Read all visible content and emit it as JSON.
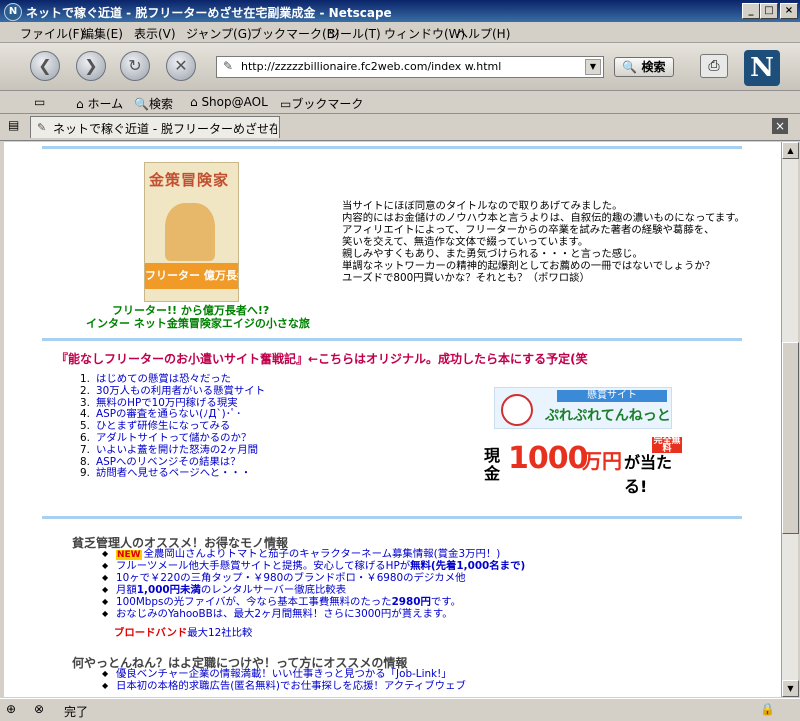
{
  "window": {
    "title": "ネットで稼ぐ近道 - 脱フリーターめざせ在宅副業成金 - Netscape",
    "btn_min": "_",
    "btn_max": "□",
    "btn_close": "×"
  },
  "menu": [
    "ファイル(F)",
    "編集(E)",
    "表示(V)",
    "ジャンプ(G)",
    "ブックマーク(B)",
    "ツール(T)",
    "ウィンドウ(W)",
    "ヘルプ(H)"
  ],
  "nav": {
    "url": "http://zzzzzbillionaire.fc2web.com/index w.html",
    "search_label": "検索",
    "back_glyph": "❮",
    "forward_glyph": "❯",
    "reload_glyph": "↻",
    "stop_glyph": "✕",
    "logo_text": "N"
  },
  "personal_toolbar": {
    "home": "ホーム",
    "search": "検索",
    "shop": "Shop@AOL",
    "bookmarks": "ブックマーク"
  },
  "tab": {
    "label": "ネットで稼ぐ近道 - 脱フリーターめざせ在宅副…"
  },
  "book": {
    "cover_title": "金策冒険家",
    "cover_band": "フリーター 億万長者",
    "caption_line1": "フリーター!! から億万長者へ!?",
    "caption_line2": "インター ネット金策冒険家エイジの小さな旅"
  },
  "intro_lines": [
    "当サイトにほぼ同意のタイトルなので取りあげてみました。",
    "内容的にはお金儲けのノウハウ本と言うよりは、自叙伝的趣の濃いものになってます。",
    "アフィリエイトによって、フリーターからの卒業を試みた著者の経験や葛藤を、",
    "笑いを交えて、無造作な文体で綴っていっています。",
    "親しみやすくもあり、また勇気づけられる・・・と言った感じ。",
    "単調なネットワーカーの精神的起爆剤としてお薦めの一冊ではないでしょうか？",
    "ユーズドで800円買いかな？それとも？（ポワロ談）"
  ],
  "section1": {
    "heading": "『能なしフリーターのお小遣いサイト奮戦記』←こちらはオリジナル。成功したら本にする予定(笑",
    "items": [
      "はじめての懸賞は恐々だった",
      "30万人もの利用者がいる懸賞サイト",
      "無料のHPで10万円稼げる現実",
      "ASPの審査を通らない(ﾉД`)･ﾟ･",
      "ひとまず研修生になってみる",
      "アダルトサイトって儲かるのか？",
      "いよいよ蓋を開けた怒涛の2ヶ月間",
      "ASPへのリベンジその結果は？",
      "訪問者へ見せるページへと・・・"
    ],
    "banner1_tag": "懸賞サイト",
    "banner1_name": "ぷれぷれてんねっと",
    "banner2_prefix": "現金",
    "banner2_amount": "1000",
    "banner2_unit": "万円",
    "banner2_suffix": "が当たる!",
    "banner2_badge": "完全無料"
  },
  "section2": {
    "heading": "貧乏管理人のオススメ！お得なモノ情報",
    "new_badge": "NEW",
    "items": [
      {
        "text": "全農岡山さんよりトマトと茄子のキャラクターネーム募集情報(賞金3万円！)"
      },
      {
        "text": "フルーツメール他大手懸賞サイトと提携。安心して稼げるHPが",
        "em": "無料(先着1,000名まで)"
      },
      {
        "text": "10ヶで￥220の三角タップ・￥980のブランドポロ・￥6980のデジカメ他"
      },
      {
        "text": "月額",
        "em": "1,000円未満",
        "tail": "のレンタルサーバー徹底比較表"
      },
      {
        "text": "100Mbpsの光ファイバが、今なら基本工事費無料のたった",
        "em": "2980円",
        "tail": "です。"
      },
      {
        "text": "おなじみのYahooBBは、最大2ヶ月間無料！さらに3000円が貰えます。"
      }
    ],
    "broadband_label": "ブロードバンド",
    "broadband_tail": "最大12社比較"
  },
  "section3": {
    "heading": "何やっとんねん？はよ定職につけや！って方にオススメの情報",
    "items": [
      "優良ベンチャー企業の情報満載！いい仕事きっと見つかる「Job-Link!」",
      "日本初の本格的求職広告(匿名無料)でお仕事探しを応援！アクティブウェブ"
    ]
  },
  "status": {
    "text": "完了"
  }
}
